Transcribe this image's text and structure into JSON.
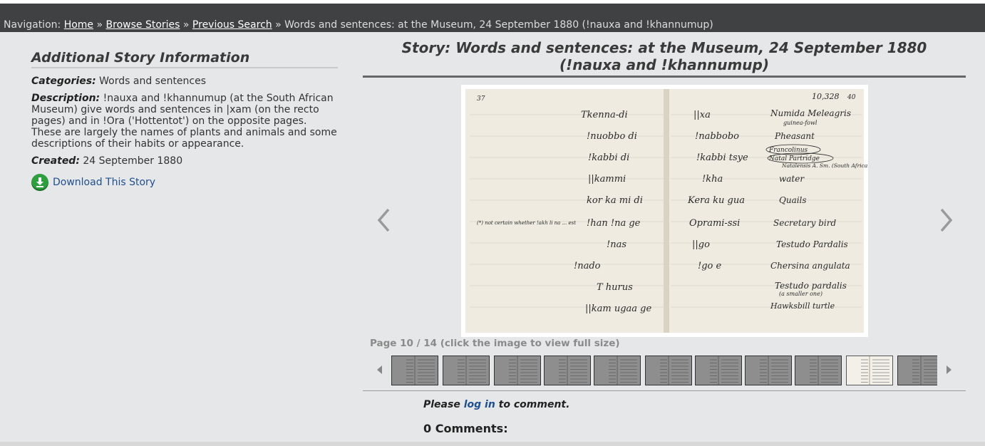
{
  "navigation": {
    "prefix": "Navigation:",
    "links": [
      "Home",
      "Browse Stories",
      "Previous Search"
    ],
    "separator": "»",
    "current": "Words and sentences: at the Museum, 24 September 1880 (!nauxa and !khannumup)"
  },
  "sidebar": {
    "title": "Additional Story Information",
    "categories_label": "Categories:",
    "categories_value": "Words and sentences",
    "description_label": "Description:",
    "description_value": "!nauxa and !khannumup (at the South African Museum) give words and sentences in |xam (on the recto pages) and in !Ora ('Hottentot') on the opposite pages. These are largely the names of plants and animals and some descriptions of their habits or appearance.",
    "created_label": "Created:",
    "created_value": "24 September 1880",
    "download_label": "Download This Story",
    "download_icon": "download-arrow-icon"
  },
  "story": {
    "title": "Story: Words and sentences: at the Museum, 24 September 1880 (!nauxa and !khannumup)",
    "page_caption": "Page 10 / 14 (click the image to view full size)",
    "current_page": 10,
    "total_pages": 14,
    "prev_icon": "chevron-left-icon",
    "next_icon": "chevron-right-icon",
    "thumb_count_visible": 11,
    "active_thumb_index": 9,
    "notebook": {
      "left_corner": "37",
      "right_corner": "10,328",
      "right_corner_small": "40",
      "margin_note": "(*) not certain whether !akh li na ... est",
      "left_col": [
        "Tkenna-di",
        "!nuobbo di",
        "!kabbi di",
        "||kammi",
        "kor ka mi di",
        "!han !na ge",
        "!nas",
        "!nado",
        "T hurus",
        "||kam ugaa ge"
      ],
      "mid_col": [
        "||xa",
        "!nabbobo",
        "!kabbi tsye",
        "!kha",
        "Kera ku gua",
        "Oprami-ssi",
        "||go",
        "!go e"
      ],
      "right_col": [
        "Numida Meleagris",
        "Pheasant",
        "Francolinus",
        "Natal Partridge",
        "water",
        "Quails",
        "Secretary bird",
        "Testudo Pardalis",
        "Chersina angulata",
        "Testudo pardalis",
        "Hawksbill turtle"
      ],
      "right_sub": [
        "guinea-fowl",
        "Natalensis A. Sm. (South African)",
        "(a smaller one)"
      ]
    }
  },
  "comments": {
    "prompt_before": "Please",
    "login_label": "log in",
    "prompt_after": "to comment.",
    "count_label": "0 Comments:"
  },
  "colors": {
    "navbar_bg": "#404142",
    "page_bg": "#e6e7e8",
    "link": "#1f4f8f",
    "download_green": "#2f9e3e"
  }
}
